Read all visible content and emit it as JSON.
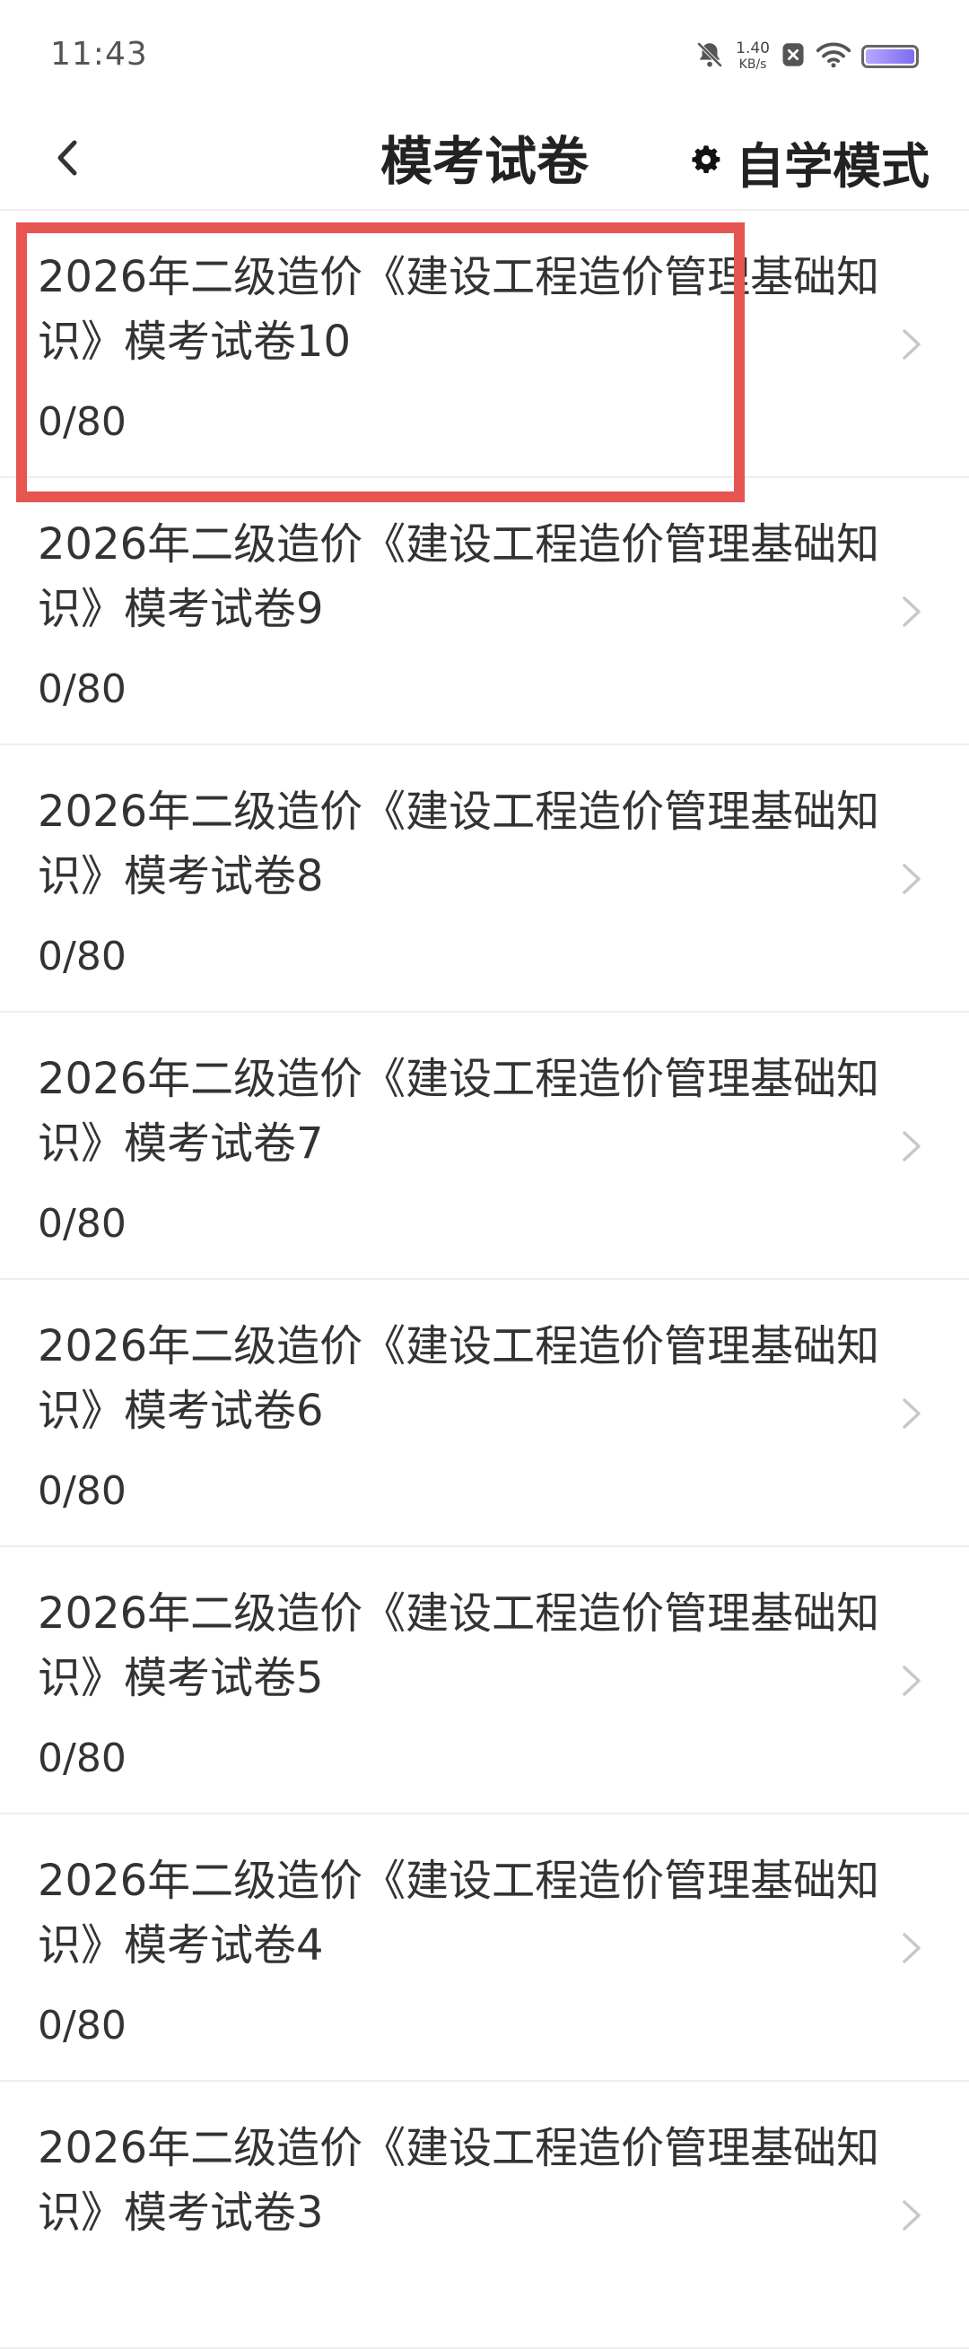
{
  "status_bar": {
    "time": "11:43",
    "net_speed_value": "1.40",
    "net_speed_unit": "KB/s",
    "icons": [
      "mute-bell-icon",
      "x-badge-icon",
      "wifi-icon",
      "battery-icon"
    ]
  },
  "header": {
    "title": "模考试卷",
    "back_icon": "chevron-left-icon",
    "mode_icon": "gear-icon",
    "mode_label": "自学模式"
  },
  "list": {
    "items": [
      {
        "title": "2026年二级造价《建设工程造价管理基础知识》模考试卷10",
        "progress": "0/80"
      },
      {
        "title": "2026年二级造价《建设工程造价管理基础知识》模考试卷9",
        "progress": "0/80"
      },
      {
        "title": "2026年二级造价《建设工程造价管理基础知识》模考试卷8",
        "progress": "0/80"
      },
      {
        "title": "2026年二级造价《建设工程造价管理基础知识》模考试卷7",
        "progress": "0/80"
      },
      {
        "title": "2026年二级造价《建设工程造价管理基础知识》模考试卷6",
        "progress": "0/80"
      },
      {
        "title": "2026年二级造价《建设工程造价管理基础知识》模考试卷5",
        "progress": "0/80"
      },
      {
        "title": "2026年二级造价《建设工程造价管理基础知识》模考试卷4",
        "progress": "0/80"
      },
      {
        "title": "2026年二级造价《建设工程造价管理基础知识》模考试卷3",
        "progress": ""
      }
    ]
  },
  "colors": {
    "highlight": "#e65550",
    "battery_fill": "#7a6df0",
    "divider": "#eeeeee"
  }
}
